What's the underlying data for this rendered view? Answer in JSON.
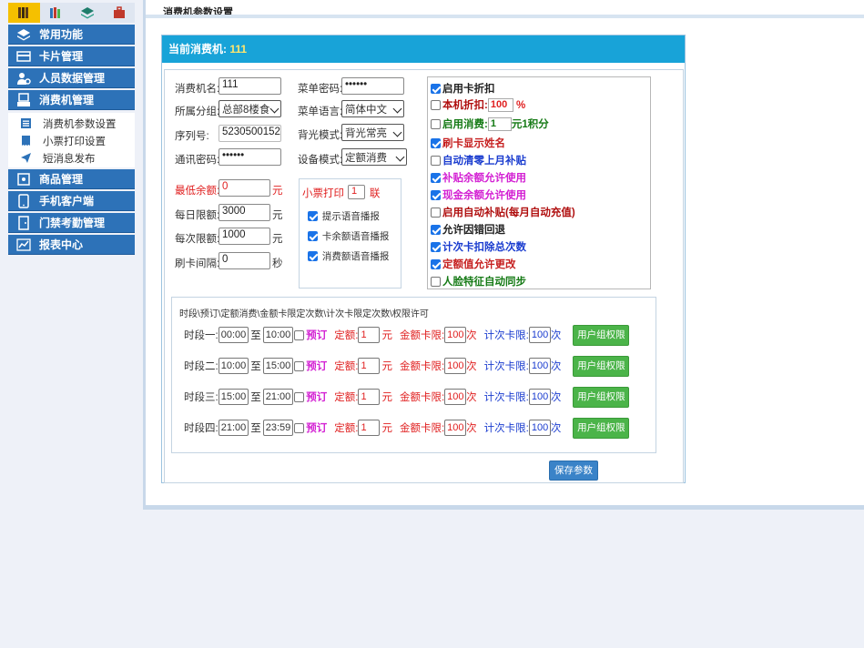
{
  "sidebar": {
    "top_tabs": [
      {
        "icon": "book-icon",
        "active": true
      },
      {
        "icon": "books-icon",
        "active": false
      },
      {
        "icon": "layers-icon",
        "active": false
      },
      {
        "icon": "toolbox-icon",
        "active": false
      }
    ],
    "menus": [
      {
        "label": "常用功能",
        "icon": "layers-icon"
      },
      {
        "label": "卡片管理",
        "icon": "card-icon"
      },
      {
        "label": "人员数据管理",
        "icon": "person-gear-icon"
      },
      {
        "label": "消费机管理",
        "icon": "terminal-icon"
      },
      {
        "label": "商品管理",
        "icon": "box-icon"
      },
      {
        "label": "手机客户端",
        "icon": "phone-icon"
      },
      {
        "label": "门禁考勤管理",
        "icon": "door-icon"
      },
      {
        "label": "报表中心",
        "icon": "chart-icon"
      }
    ],
    "sub_items": [
      {
        "label": "消费机参数设置",
        "icon": "settings-list-icon"
      },
      {
        "label": "小票打印设置",
        "icon": "receipt-icon"
      },
      {
        "label": "短消息发布",
        "icon": "message-icon"
      }
    ]
  },
  "page": {
    "title": "消费机参数设置",
    "panel_header_label": "当前消费机:",
    "panel_header_value": "111"
  },
  "form": {
    "machine_name_label": "消费机名:",
    "machine_name": "111",
    "menu_password_label": "菜单密码:",
    "menu_password": "••••••",
    "group_label": "所属分组:",
    "group_value": "总部8楼食",
    "menu_language_label": "菜单语言:",
    "menu_language": "简体中文",
    "serial_label": "序列号:",
    "serial_value": "5230500152",
    "backlight_label": "背光模式:",
    "backlight_value": "背光常亮",
    "comm_password_label": "通讯密码:",
    "comm_password": "••••••",
    "device_mode_label": "设备模式:",
    "device_mode": "定额消费",
    "min_balance_label": "最低余额:",
    "min_balance": "0",
    "min_balance_unit": "元",
    "daily_limit_label": "每日限额:",
    "daily_limit": "3000",
    "daily_limit_unit": "元",
    "per_limit_label": "每次限额:",
    "per_limit": "1000",
    "per_limit_unit": "元",
    "interval_label": "刷卡间隔:",
    "interval": "0",
    "interval_unit": "秒"
  },
  "ticket": {
    "label": "小票打印",
    "copies": "1",
    "copies_unit": "联",
    "options": [
      {
        "label": "提示语音播报",
        "checked": true
      },
      {
        "label": "卡余额语音播报",
        "checked": true
      },
      {
        "label": "消费额语音播报",
        "checked": true
      }
    ]
  },
  "options": {
    "enable_discount": "启用卡折扣",
    "local_discount": "本机折扣:",
    "local_discount_value": "100",
    "local_discount_unit": "%",
    "points_label": "启用消费:",
    "points_value": "1",
    "points_unit": "元1积分",
    "show_name": "刷卡显示姓名",
    "auto_clear": "自动清零上月补贴",
    "allow_subsidy": "补贴余额允许使用",
    "allow_cash": "现金余额允许使用",
    "auto_subsidy": "启用自动补贴(每月自动充值)",
    "allow_rollback": "允许因错回退",
    "count_deduct": "计次卡扣除总次数",
    "allow_change": "定额值允许更改",
    "face_sync": "人脸特征自动同步"
  },
  "periods": {
    "title": "时段\\预订\\定额消费\\金额卡限定次数\\计次卡限定次数\\权限许可",
    "to_label": "至",
    "reserve_label": "预订",
    "quota_label": "定额:",
    "quota_unit": "元",
    "amount_limit_label": "金额卡限:",
    "amount_limit_unit": "次",
    "count_limit_label": "计次卡限:",
    "count_limit_unit": "次",
    "button_label": "用户组权限",
    "rows": [
      {
        "label": "时段一:",
        "start": "00:00",
        "end": "10:00",
        "quota": "1",
        "amount_limit": "100",
        "count_limit": "100"
      },
      {
        "label": "时段二:",
        "start": "10:00",
        "end": "15:00",
        "quota": "1",
        "amount_limit": "100",
        "count_limit": "100"
      },
      {
        "label": "时段三:",
        "start": "15:00",
        "end": "21:00",
        "quota": "1",
        "amount_limit": "100",
        "count_limit": "100"
      },
      {
        "label": "时段四:",
        "start": "21:00",
        "end": "23:59",
        "quota": "1",
        "amount_limit": "100",
        "count_limit": "100"
      }
    ]
  },
  "save_label": "保存参数"
}
